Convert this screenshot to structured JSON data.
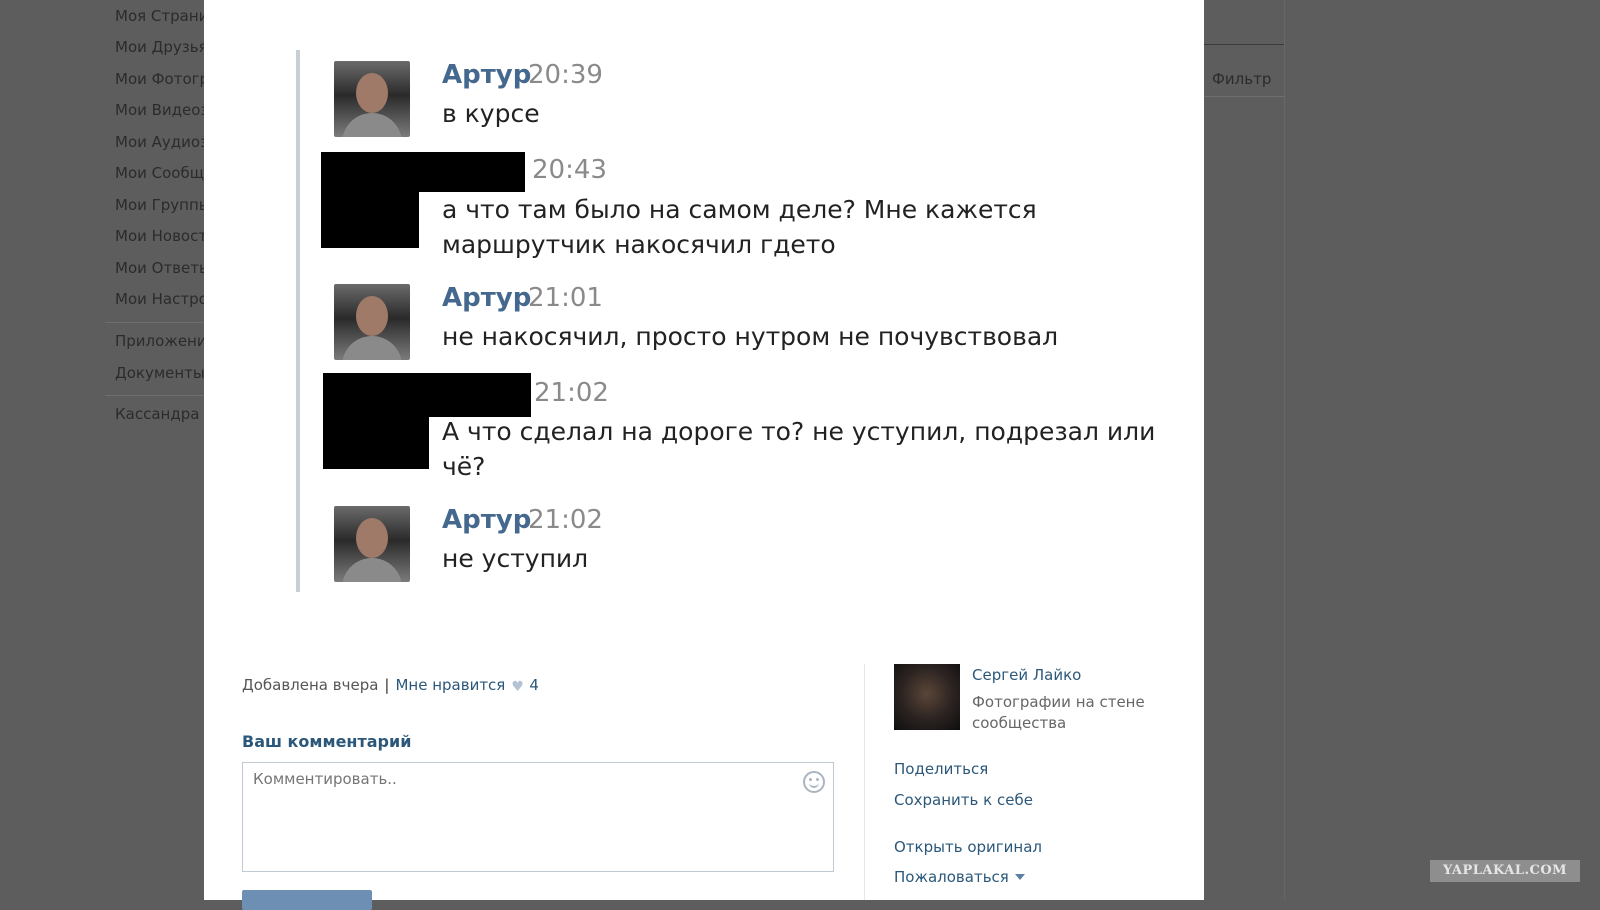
{
  "left_nav": {
    "items": [
      "Моя Страни",
      "Мои Друзья",
      "Мои Фотогр",
      "Мои Видеоз",
      "Мои Аудиоз",
      "Мои Сообщ",
      "Мои Группы",
      "Мои Новост",
      "Мои Ответы",
      "Мои Настро"
    ],
    "extra_items": [
      "Приложени",
      "Документы"
    ],
    "bottom_item": "Кассандра"
  },
  "right_area": {
    "filter_label": "Фильтр"
  },
  "chat": {
    "messages": [
      {
        "name": "Артур",
        "time": "20:39",
        "text": "в курсе",
        "redacted": false
      },
      {
        "name": "",
        "time": "20:43",
        "text": "а что там было на самом деле? Мне кажется маршрутчик накосячил гдето",
        "redacted": true
      },
      {
        "name": "Артур",
        "time": "21:01",
        "text": "не накосячил, просто нутром не почувствовал",
        "redacted": false
      },
      {
        "name": "",
        "time": "21:02",
        "text": "А что сделал на дороге то? не уступил, подрезал или чё?",
        "redacted": true
      },
      {
        "name": "Артур",
        "time": "21:02",
        "text": "не уступил",
        "redacted": false
      }
    ]
  },
  "photo_info": {
    "added": "Добавлена вчера",
    "separator": "|",
    "like_label": "Мне нравится",
    "like_count": "4"
  },
  "comment": {
    "heading": "Ваш комментарий",
    "placeholder": "Комментировать.."
  },
  "author": {
    "name": "Сергей Лайко",
    "subtitle": "Фотографии на стене сообщества"
  },
  "actions": {
    "share": "Поделиться",
    "save": "Сохранить к себе",
    "open_original": "Открыть оригинал",
    "report": "Пожаловаться"
  },
  "watermark": "YAPLAKAL.COM",
  "icons": {
    "heart": "heart-icon",
    "smile": "smile-icon",
    "caret": "chevron-down-icon"
  }
}
